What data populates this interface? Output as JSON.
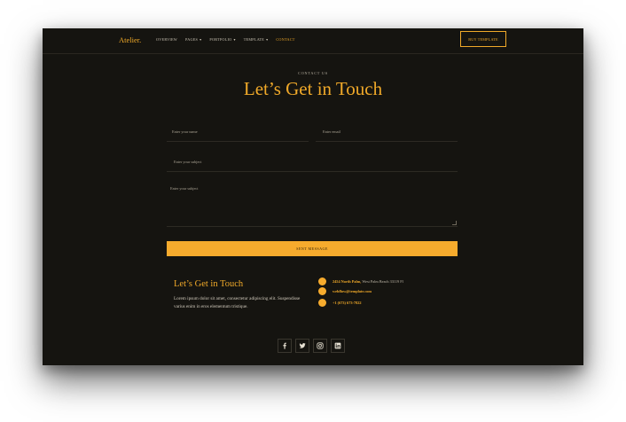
{
  "brand": {
    "logo": "Atelier."
  },
  "nav": {
    "items": [
      {
        "label": "OVERVIEW",
        "caret": false,
        "active": false
      },
      {
        "label": "PAGES",
        "caret": true,
        "active": false
      },
      {
        "label": "PORTFOLIO",
        "caret": true,
        "active": false
      },
      {
        "label": "TEMPLATE",
        "caret": true,
        "active": false
      },
      {
        "label": "CONTACT",
        "caret": false,
        "active": true
      }
    ],
    "buy_label": "BUY TEMPLATE"
  },
  "hero": {
    "eyebrow": "CONTACT US",
    "title": "Let’s Get in Touch"
  },
  "form": {
    "name_placeholder": "Enter your name",
    "email_placeholder": "Enter email",
    "subject_placeholder": "Enter your subject",
    "message_placeholder": "Enter your subject",
    "send_label": "SENT MESSAGE"
  },
  "info": {
    "title": "Let’s Get in Touch",
    "text": "Lorem ipsum dolor sit amet, consectetur adipiscing elit. Suspendisse varius enim in eros elementum tristique.",
    "address_strong": "2454 North Palm,",
    "address_rest": " West Palm Beach 33119 Fl",
    "email": "webflow@template.com",
    "phone": "+1 (673) 673-7822"
  },
  "social": [
    "facebook-icon",
    "twitter-icon",
    "instagram-icon",
    "linkedin-icon"
  ],
  "colors": {
    "background": "#151410",
    "accent": "#f0a929",
    "button": "#f6ab2d"
  }
}
